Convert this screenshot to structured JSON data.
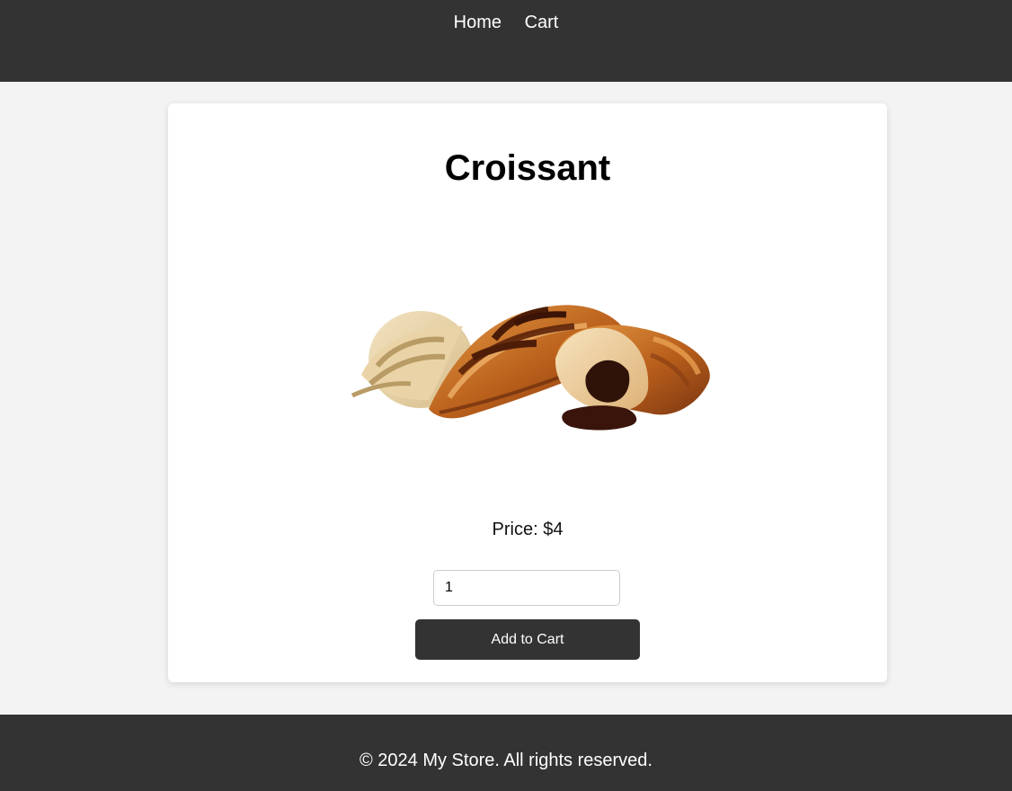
{
  "nav": {
    "items": [
      {
        "label": "Home"
      },
      {
        "label": "Cart"
      }
    ]
  },
  "product": {
    "title": "Croissant",
    "price_text": "Price: $4",
    "image_name": "croissant-photo"
  },
  "cart_form": {
    "quantity_value": "1",
    "add_button_label": "Add to Cart"
  },
  "footer": {
    "text": "© 2024 My Store. All rights reserved."
  },
  "colors": {
    "header_bg": "#333333",
    "page_bg": "#f3f3f3",
    "card_bg": "#ffffff",
    "button_bg": "#333333"
  }
}
